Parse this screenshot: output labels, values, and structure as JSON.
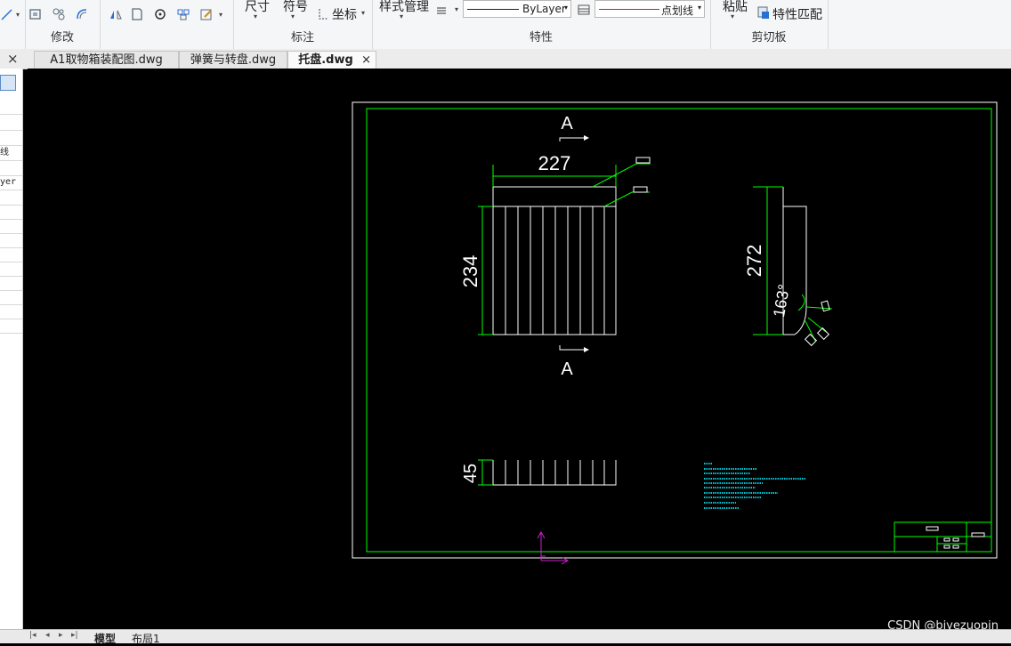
{
  "ribbon": {
    "modify_label": "修改",
    "annotate_label": "标注",
    "annotate_dimension": "尺寸",
    "annotate_symbol": "符号",
    "annotate_coordinate": "坐标",
    "properties_label": "特性",
    "style_manager": "样式管理",
    "linetype_value": "ByLayer",
    "color_value": "点划线",
    "clipboard_label": "剪切板",
    "paste_label": "粘贴",
    "match_properties_label": "特性匹配"
  },
  "tabs": [
    {
      "label": "A1取物箱装配图.dwg"
    },
    {
      "label": "弹簧与转盘.dwg"
    },
    {
      "label": "托盘.dwg"
    }
  ],
  "left_panel": {
    "close_glyph": "×",
    "row_linetype": "线",
    "row_layer": "yer"
  },
  "drawing": {
    "dim_width": "227",
    "dim_height_front": "234",
    "dim_height_side": "272",
    "dim_angle": "163°",
    "dim_bottom": "45",
    "section_label_top": "A",
    "section_label_bottom": "A"
  },
  "bottom": {
    "model_tab": "模型",
    "layout_tab": "布局1"
  },
  "watermark": "CSDN @biyezuopin",
  "colors": {
    "accent_green": "#00ff00",
    "drawing_white": "#ffffff",
    "ucs_magenta": "#d020d0",
    "text_cyan": "#00c8d8"
  }
}
